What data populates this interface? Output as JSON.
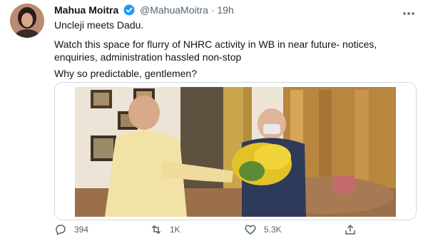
{
  "tweet": {
    "author_name": "Mahua Moitra",
    "handle": "@MahuaMoitra",
    "separator": "·",
    "time": "19h",
    "more_icon": "more-horizontal-icon",
    "text_line1": "Uncleji meets Dadu.",
    "text_line2": "Watch this space for flurry of NHRC activity in WB in near future- notices,\nenquiries, administration hassled non-stop",
    "text_line3": "Why so predictable, gentlemen?"
  },
  "actions": {
    "reply_count": "394",
    "retweet_count": "1K",
    "like_count": "5.3K",
    "icons": [
      "reply-icon",
      "retweet-icon",
      "like-icon",
      "share-icon"
    ]
  },
  "colors": {
    "verified": "#1d9bf0",
    "muted": "#536471",
    "text": "#0f1419"
  }
}
